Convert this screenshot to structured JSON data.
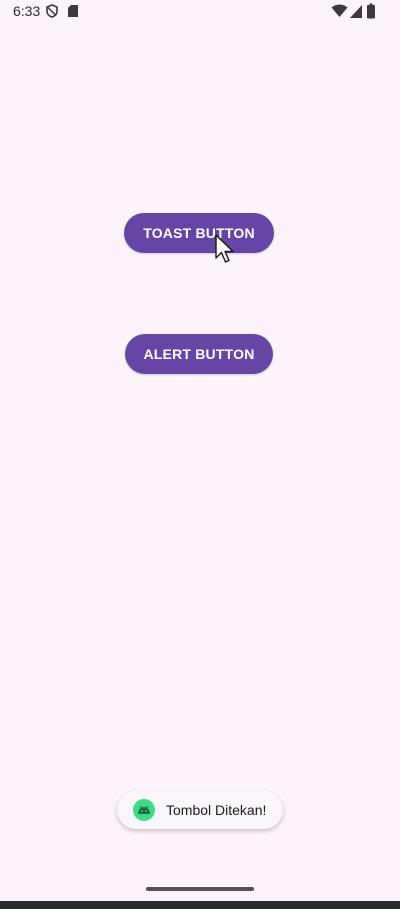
{
  "status_bar": {
    "time": "6:33",
    "left_icons": [
      "shield-icon",
      "sd-card-icon"
    ],
    "right_icons": [
      "wifi-icon",
      "cell-signal-icon",
      "battery-icon"
    ]
  },
  "buttons": {
    "toast_label": "TOAST BUTTON",
    "alert_label": "ALERT BUTTON"
  },
  "toast": {
    "icon": "android-icon",
    "message": "Tombol Ditekan!"
  },
  "colors": {
    "background": "#fdf3fb",
    "button": "#6745a6",
    "toast_icon": "#3ddc84"
  }
}
